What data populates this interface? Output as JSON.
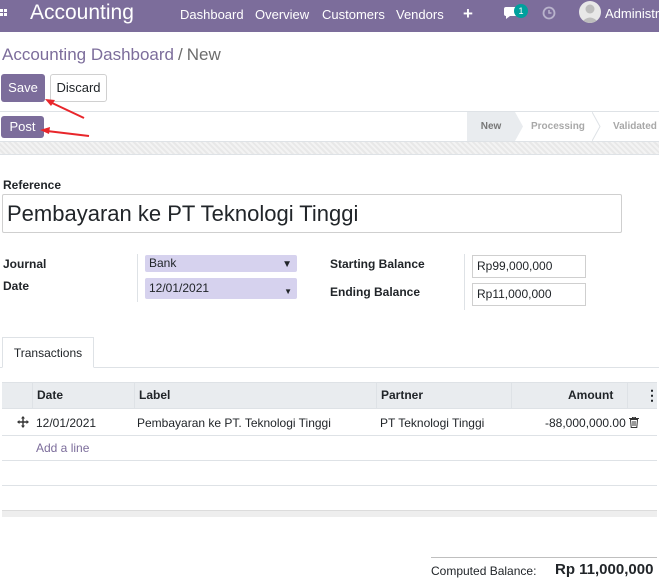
{
  "navbar": {
    "app_title": "Accounting",
    "menu": [
      "Dashboard",
      "Overview",
      "Customers",
      "Vendors"
    ],
    "plus": "+",
    "chat_count": "1",
    "user": "Administra"
  },
  "breadcrumb": {
    "parent": "Accounting Dashboard",
    "separator": "/",
    "current": "New"
  },
  "buttons": {
    "save": "Save",
    "discard": "Discard",
    "post": "Post"
  },
  "statusbar": {
    "stages": [
      "New",
      "Processing",
      "Validated"
    ],
    "active_stage": "New"
  },
  "form": {
    "reference_label": "Reference",
    "reference_value": "Pembayaran ke PT Teknologi Tinggi",
    "journal_label": "Journal",
    "journal_value": "Bank",
    "date_label": "Date",
    "date_value": "12/01/2021",
    "starting_balance_label": "Starting Balance",
    "starting_balance_value": "Rp99,000,000",
    "ending_balance_label": "Ending Balance",
    "ending_balance_value": "Rp11,000,000"
  },
  "tabs": [
    "Transactions"
  ],
  "table": {
    "columns": [
      "Date",
      "Label",
      "Partner",
      "Amount"
    ],
    "rows": [
      {
        "date": "12/01/2021",
        "label": "Pembayaran ke PT. Teknologi Tinggi",
        "partner": "PT Teknologi Tinggi",
        "amount": "-88,000,000.00"
      }
    ],
    "add_line": "Add a line"
  },
  "summary": {
    "computed_label": "Computed Balance:",
    "computed_value": "Rp 11,000,000"
  },
  "colors": {
    "brand": "#7c6d9b",
    "annotation_arrow": "#e8262b",
    "select_bg": "#d6d2ee"
  }
}
